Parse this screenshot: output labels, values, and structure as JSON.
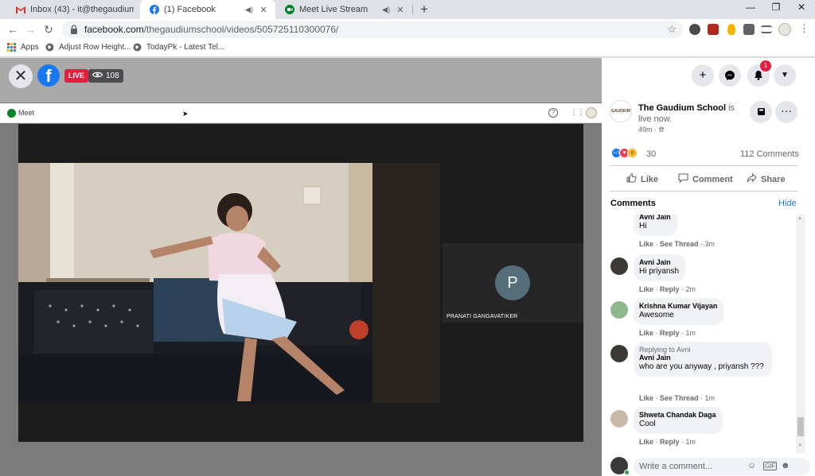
{
  "tabs": [
    {
      "title": "Inbox (43) - it@thegaudium.com",
      "icon": "gmail-icon"
    },
    {
      "title": "(1) Facebook",
      "icon": "facebook-icon"
    },
    {
      "title": "Meet Live Stream",
      "icon": "meet-icon"
    }
  ],
  "address": {
    "host": "facebook.com",
    "path": "/thegaudiumschool/videos/505725110300076/"
  },
  "bookmarks": [
    {
      "label": "Apps"
    },
    {
      "label": "Adjust Row Height..."
    },
    {
      "label": "TodayPk - Latest Tel..."
    }
  ],
  "video": {
    "live_label": "LIVE",
    "viewer_count": "108"
  },
  "meet": {
    "app_name": "Meet",
    "participant": {
      "initial": "P",
      "name": "PRANATI GANGAVATIKER"
    }
  },
  "post": {
    "page_name": "The Gaudium School",
    "status": " is live now.",
    "time": "49m",
    "reaction_count": "30",
    "comment_count": "112 Comments",
    "actions": {
      "like": "Like",
      "comment": "Comment",
      "share": "Share"
    },
    "page_avatar_text": "GAUDIUM"
  },
  "notifications": {
    "badge": "1"
  },
  "comments_section": {
    "heading": "Comments",
    "hide": "Hide",
    "composer_placeholder": "Write a comment...",
    "items": [
      {
        "author": "Avni Jain",
        "replying_to": "",
        "text": "Hi",
        "like": "Like",
        "action": "See Thread",
        "time": "3m"
      },
      {
        "author": "Avni Jain",
        "replying_to": "",
        "text": "Hi priyansh",
        "like": "Like",
        "action": "Reply",
        "time": "2m"
      },
      {
        "author": "Krishna Kumar Vijayan",
        "replying_to": "",
        "text": "Awesome",
        "like": "Like",
        "action": "Reply",
        "time": "1m"
      },
      {
        "author": "Avni Jain",
        "replying_to": "Replying to Avni",
        "text": "who are you anyway , priyansh ???",
        "like": "Like",
        "action": "See Thread",
        "time": "1m"
      },
      {
        "author": "Shweta Chandak Daga",
        "replying_to": "",
        "text": "Cool",
        "like": "Like",
        "action": "Reply",
        "time": "1m"
      }
    ]
  },
  "colors": {
    "facebook_blue": "#1877f2",
    "live_red": "#e41e3f",
    "meet_green": "#00832d"
  }
}
